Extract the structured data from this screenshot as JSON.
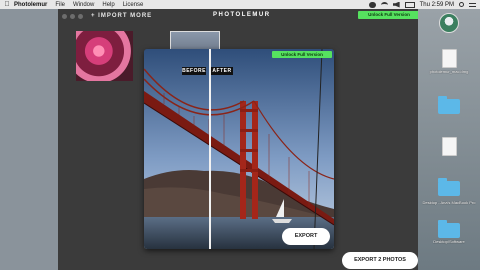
{
  "menubar": {
    "app_name": "Photolemur",
    "items": [
      "File",
      "Window",
      "Help",
      "License"
    ],
    "clock": "Thu 2:59 PM"
  },
  "window": {
    "import_more": "+ IMPORT MORE",
    "brand": "PHOTOLEMUR",
    "unlock_label": "Unlock Full Version"
  },
  "panel": {
    "before_label": "BEFORE",
    "after_label": "AFTER",
    "unlock_label": "Unlock Full Version",
    "export_label": "EXPORT"
  },
  "footer": {
    "export_photos_label": "EXPORT 2 PHOTOS"
  },
  "desktop": {
    "items": [
      {
        "label": "",
        "icon": "user-avatar-icon"
      },
      {
        "label": "photolemur_mac.dmg",
        "icon": "doc-icon"
      },
      {
        "label": "",
        "icon": "folder-icon"
      },
      {
        "label": "",
        "icon": "doc-icon"
      },
      {
        "label": "",
        "icon": "folder-icon"
      },
      {
        "label": "Desktop - Ana's MacBook Pro",
        "icon": "folder-icon"
      },
      {
        "label": "Desktop/Software",
        "icon": "folder-icon"
      }
    ]
  },
  "colors": {
    "accent_green": "#56e25f",
    "window_bg": "#3b3b3b"
  }
}
